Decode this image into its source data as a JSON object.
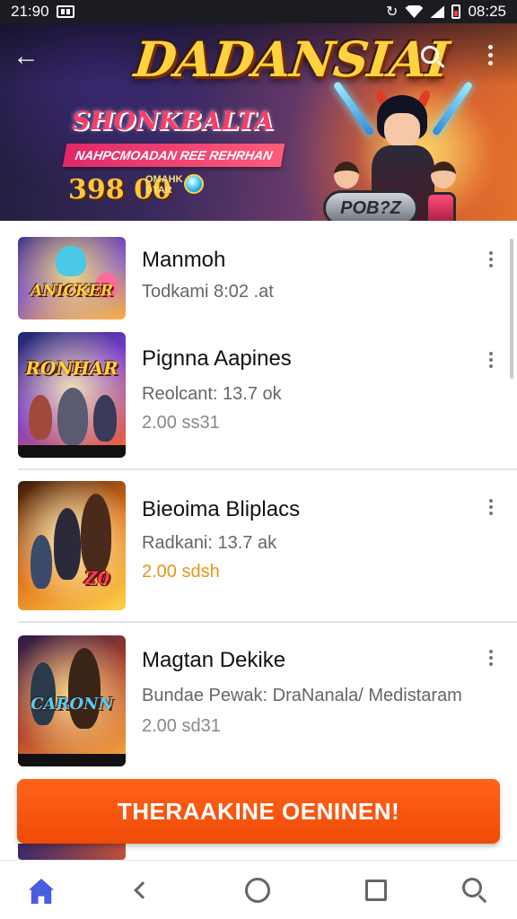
{
  "status_bar": {
    "time": "21:90",
    "right_time": "08:25"
  },
  "header": {
    "app_title": "DADANSIAI",
    "headline": "SHONKBALTA",
    "ribbon": "NAHPCMOADAN REE REHRHAN",
    "amount": "398 00",
    "amount_note": "OMAHK DTAR",
    "badge_text": "POB?Z"
  },
  "games": [
    {
      "title": "Manmoh",
      "line1": "Todkami 8:02 .at",
      "price": "",
      "thumb_logo": "ANICKER"
    },
    {
      "title": "Pignna Aapines",
      "line1": "Reolcant: 13.7 ok",
      "price": "2.00 ss31",
      "thumb_logo": "RONHAR"
    },
    {
      "title": "Bieoima Bliplacs",
      "line1": "Radkani: 13.7 ak",
      "price": "2.00 sdsh",
      "thumb_logo": "Z0"
    },
    {
      "title": "Magtan Dekike",
      "line1": "Bundae Pewak: DraNanala/ Medistaram",
      "price": "2.00 sd31",
      "thumb_logo": "CARONN"
    }
  ],
  "cta": {
    "label": "THERAAKINE OENINEN!"
  },
  "peek": {
    "text": ""
  },
  "colors": {
    "accent": "#f2560c",
    "price_orange": "#e8941a",
    "nav_active": "#4a5ce0"
  },
  "icons": [
    "back-arrow-icon",
    "search-icon",
    "more-vert-icon",
    "home-icon",
    "back-chevron-icon",
    "circle-icon",
    "square-icon",
    "search-icon"
  ]
}
